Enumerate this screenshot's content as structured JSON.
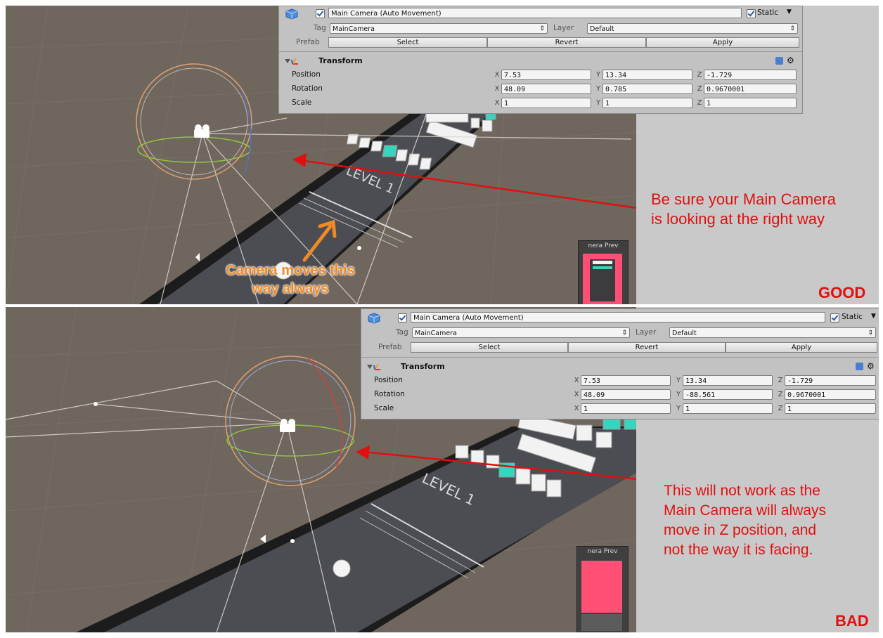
{
  "panels": [
    {
      "inspector": {
        "object_name": "Main Camera (Auto Movement)",
        "static_label": "Static",
        "tag_label": "Tag",
        "tag_value": "MainCamera",
        "layer_label": "Layer",
        "layer_value": "Default",
        "prefab_label": "Prefab",
        "buttons": {
          "select": "Select",
          "revert": "Revert",
          "apply": "Apply"
        },
        "component_title": "Transform",
        "rows": [
          {
            "label": "Position",
            "x": "7.53",
            "y": "13.34",
            "z": "-1.729"
          },
          {
            "label": "Rotation",
            "x": "48.09",
            "y": "0.785",
            "z": "0.9670001"
          },
          {
            "label": "Scale",
            "x": "1",
            "y": "1",
            "z": "1"
          }
        ],
        "axis_labels": {
          "x": "X",
          "y": "Y",
          "z": "Z"
        }
      },
      "annotation": "Be sure your Main Camera is looking at the right way",
      "annotation_lines": [
        "Be sure your Main Camera",
        "is looking at the right way"
      ],
      "orange_note_lines": [
        "Camera moves this",
        "way always"
      ],
      "verdict": "GOOD",
      "track_text": "LEVEL 1",
      "preview_label": "nera Prev"
    },
    {
      "inspector": {
        "object_name": "Main Camera (Auto Movement)",
        "static_label": "Static",
        "tag_label": "Tag",
        "tag_value": "MainCamera",
        "layer_label": "Layer",
        "layer_value": "Default",
        "prefab_label": "Prefab",
        "buttons": {
          "select": "Select",
          "revert": "Revert",
          "apply": "Apply"
        },
        "component_title": "Transform",
        "rows": [
          {
            "label": "Position",
            "x": "7.53",
            "y": "13.34",
            "z": "-1.729"
          },
          {
            "label": "Rotation",
            "x": "48.09",
            "y": "-88.561",
            "z": "0.9670001"
          },
          {
            "label": "Scale",
            "x": "1",
            "y": "1",
            "z": "1"
          }
        ],
        "axis_labels": {
          "x": "X",
          "y": "Y",
          "z": "Z"
        }
      },
      "annotation_lines": [
        "This will not work as the",
        "Main Camera will always",
        "move in Z position, and",
        "not the way it is facing."
      ],
      "verdict": "BAD",
      "track_text": "LEVEL 1",
      "preview_label": "nera Prev"
    }
  ],
  "colors": {
    "annotation_red": "#e01010",
    "orange_arrow": "#f08a24",
    "accent_teal": "#35d6c0",
    "preview_pink": "#ff4f75",
    "scene_ground": "#6f665e",
    "track": "#4c4d52"
  },
  "icons": [
    "unity-cube-icon",
    "transform-axes-icon",
    "help-book-icon",
    "gear-icon",
    "camera-gizmo-icon",
    "sun-icon",
    "dropdown-arrow-icon"
  ]
}
